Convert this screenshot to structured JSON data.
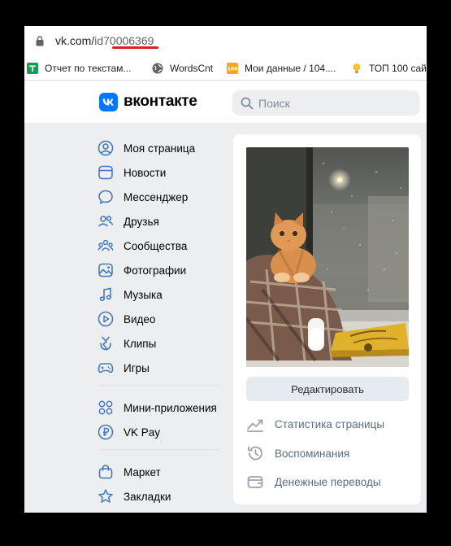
{
  "browser": {
    "url_host": "vk.com/",
    "url_path": "id70006369",
    "highlight_color": "#e01c24"
  },
  "bookmarks": [
    {
      "label": "Отчет по текстам...",
      "icon": "sheets-icon"
    },
    {
      "label": "WordsCnt",
      "icon": "globe-icon"
    },
    {
      "label": "Мои данные / 104....",
      "icon": "site-104-icon"
    },
    {
      "label": "ТОП 100 сай",
      "icon": "lightbulb-icon"
    }
  ],
  "header": {
    "logo_text": "вконтакте",
    "search_placeholder": "Поиск",
    "brand_color": "#0077ff"
  },
  "sidebar": {
    "items": [
      {
        "label": "Моя страница",
        "icon": "user-circle-icon"
      },
      {
        "label": "Новости",
        "icon": "news-icon"
      },
      {
        "label": "Мессенджер",
        "icon": "message-icon"
      },
      {
        "label": "Друзья",
        "icon": "friends-icon"
      },
      {
        "label": "Сообщества",
        "icon": "communities-icon"
      },
      {
        "label": "Фотографии",
        "icon": "photo-icon"
      },
      {
        "label": "Музыка",
        "icon": "music-icon"
      },
      {
        "label": "Видео",
        "icon": "video-icon"
      },
      {
        "label": "Клипы",
        "icon": "clips-icon"
      },
      {
        "label": "Игры",
        "icon": "games-icon"
      },
      {
        "label": "Мини-приложения",
        "icon": "apps-icon"
      },
      {
        "label": "VK Pay",
        "icon": "vkpay-icon"
      },
      {
        "label": "Маркет",
        "icon": "market-icon"
      },
      {
        "label": "Закладки",
        "icon": "star-icon"
      }
    ]
  },
  "profile": {
    "edit_button": "Редактировать",
    "links": [
      {
        "label": "Статистика страницы",
        "icon": "stats-icon"
      },
      {
        "label": "Воспоминания",
        "icon": "memories-icon"
      },
      {
        "label": "Денежные переводы",
        "icon": "money-transfer-icon"
      }
    ]
  }
}
